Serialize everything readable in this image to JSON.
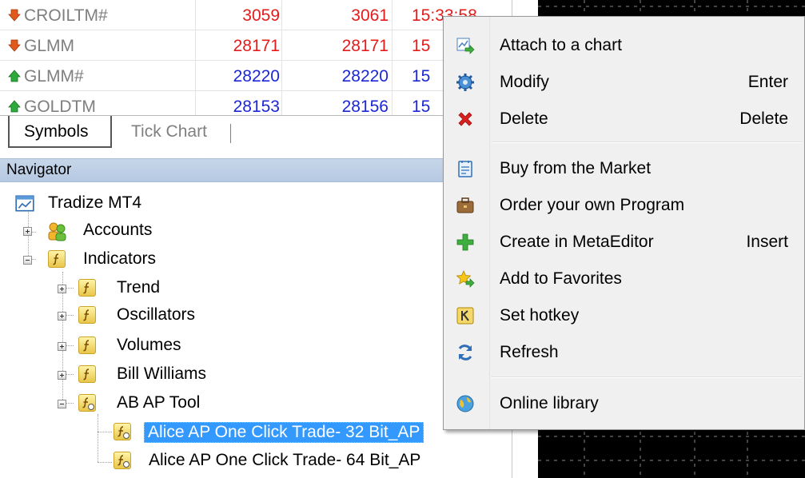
{
  "market_watch": {
    "rows": [
      {
        "symbol": "CROILTM#",
        "direction": "down",
        "bid": "3059",
        "ask": "3061",
        "time": "15:33:58",
        "color": "red"
      },
      {
        "symbol": "GLMM",
        "direction": "down",
        "bid": "28171",
        "ask": "28171",
        "time": "15",
        "color": "red"
      },
      {
        "symbol": "GLMM#",
        "direction": "up",
        "bid": "28220",
        "ask": "28220",
        "time": "15",
        "color": "blue"
      },
      {
        "symbol": "GOLDTM",
        "direction": "up",
        "bid": "28153",
        "ask": "28156",
        "time": "15",
        "color": "blue"
      }
    ]
  },
  "tabs": {
    "symbols": "Symbols",
    "tick_chart": "Tick Chart"
  },
  "navigator": {
    "title": "Navigator",
    "root": "Tradize MT4",
    "accounts": "Accounts",
    "indicators": "Indicators",
    "children": [
      "Trend",
      "Oscillators",
      "Volumes",
      "Bill Williams",
      "AB AP Tool"
    ],
    "ab_ap_items": [
      "Alice AP One Click Trade- 32 Bit_AP",
      "Alice AP One Click Trade- 64 Bit_AP"
    ]
  },
  "context_menu": {
    "items": [
      {
        "label": "Attach to a chart",
        "shortcut": "",
        "icon": "attach-chart-icon"
      },
      {
        "label": "Modify",
        "shortcut": "Enter",
        "icon": "gear-icon"
      },
      {
        "label": "Delete",
        "shortcut": "Delete",
        "icon": "delete-x-icon"
      },
      {
        "label": "Buy from the Market",
        "shortcut": "",
        "icon": "market-icon"
      },
      {
        "label": "Order your own Program",
        "shortcut": "",
        "icon": "briefcase-icon"
      },
      {
        "label": "Create in MetaEditor",
        "shortcut": "Insert",
        "icon": "plus-icon"
      },
      {
        "label": "Add to Favorites",
        "shortcut": "",
        "icon": "star-icon"
      },
      {
        "label": "Set hotkey",
        "shortcut": "",
        "icon": "hotkey-icon"
      },
      {
        "label": "Refresh",
        "shortcut": "",
        "icon": "refresh-icon"
      },
      {
        "label": "Online library",
        "shortcut": "",
        "icon": "globe-icon"
      }
    ]
  },
  "colors": {
    "price_down": "#e41b1b",
    "price_up": "#1b27d6",
    "selection": "#3399ff",
    "nav_header": "#b5c9e2"
  }
}
